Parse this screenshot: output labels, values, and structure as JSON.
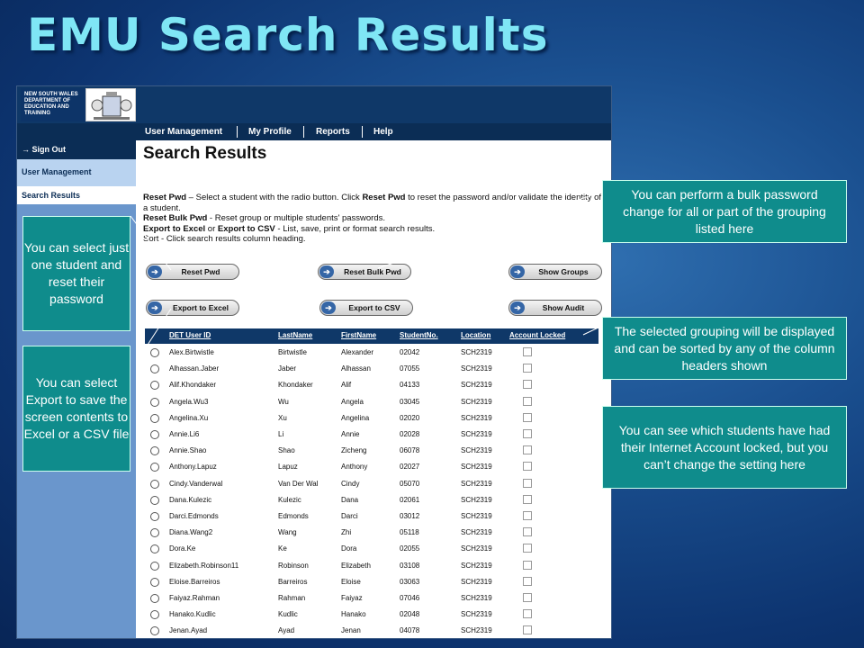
{
  "slide": {
    "title": "EMU Search Results"
  },
  "app": {
    "logo_text": "NEW SOUTH WALES DEPARTMENT OF EDUCATION AND TRAINING",
    "nav": [
      "User Management",
      "My Profile",
      "Reports",
      "Help"
    ],
    "sidebar": {
      "signout": "→ Sign Out",
      "user_management": "User Management",
      "search_results": "Search Results"
    },
    "page_heading": "Search Results",
    "instructions": {
      "reset_pwd_label": "Reset Pwd",
      "reset_pwd_pre": " – Select a student with the radio button. Click ",
      "reset_pwd_label2": "Reset Pwd",
      "reset_pwd_post": " to reset the password and/or validate the identity of a student.",
      "bulk_label": "Reset Bulk Pwd",
      "bulk_text": " - Reset group or multiple students' passwords.",
      "export_label": "Export to Excel",
      "export_or": " or ",
      "export_label2": "Export to CSV",
      "export_text": " - List, save, print or format search results.",
      "sort_text": "Sort - Click search results column heading."
    },
    "buttons": {
      "reset_pwd": "Reset Pwd",
      "reset_bulk": "Reset Bulk Pwd",
      "show_groups": "Show Groups",
      "export_excel": "Export to Excel",
      "export_csv": "Export to CSV",
      "show_audit": "Show Audit"
    },
    "table": {
      "headers": [
        "DET User ID",
        "LastName",
        "FirstName",
        "StudentNo.",
        "Location",
        "Account Locked"
      ],
      "rows": [
        [
          "Alex.Birtwistle",
          "Birtwistle",
          "Alexander",
          "02042",
          "SCH2319"
        ],
        [
          "Alhassan.Jaber",
          "Jaber",
          "Alhassan",
          "07055",
          "SCH2319"
        ],
        [
          "Alif.Khondaker",
          "Khondaker",
          "Alif",
          "04133",
          "SCH2319"
        ],
        [
          "Angela.Wu3",
          "Wu",
          "Angela",
          "03045",
          "SCH2319"
        ],
        [
          "Angelina.Xu",
          "Xu",
          "Angelina",
          "02020",
          "SCH2319"
        ],
        [
          "Annie.Li6",
          "Li",
          "Annie",
          "02028",
          "SCH2319"
        ],
        [
          "Annie.Shao",
          "Shao",
          "Zicheng",
          "06078",
          "SCH2319"
        ],
        [
          "Anthony.Lapuz",
          "Lapuz",
          "Anthony",
          "02027",
          "SCH2319"
        ],
        [
          "Cindy.Vanderwal",
          "Van Der Wal",
          "Cindy",
          "05070",
          "SCH2319"
        ],
        [
          "Dana.Kulezic",
          "Kulezic",
          "Dana",
          "02061",
          "SCH2319"
        ],
        [
          "Darci.Edmonds",
          "Edmonds",
          "Darci",
          "03012",
          "SCH2319"
        ],
        [
          "Diana.Wang2",
          "Wang",
          "Zhi",
          "05118",
          "SCH2319"
        ],
        [
          "Dora.Ke",
          "Ke",
          "Dora",
          "02055",
          "SCH2319"
        ],
        [
          "Elizabeth.Robinson11",
          "Robinson",
          "Elizabeth",
          "03108",
          "SCH2319"
        ],
        [
          "Eloise.Barreiros",
          "Barreiros",
          "Eloise",
          "03063",
          "SCH2319"
        ],
        [
          "Faiyaz.Rahman",
          "Rahman",
          "Faiyaz",
          "07046",
          "SCH2319"
        ],
        [
          "Hanako.Kudlic",
          "Kudlic",
          "Hanako",
          "02048",
          "SCH2319"
        ],
        [
          "Jenan.Ayad",
          "Ayad",
          "Jenan",
          "04078",
          "SCH2319"
        ]
      ]
    }
  },
  "callouts": {
    "select_one": "You can select just one student and reset their password",
    "select_export": "You can select Export to save the screen contents to Excel or a CSV file",
    "bulk_password": "You can perform a bulk password change for all or part of the grouping listed here",
    "grouping": "The selected grouping will be displayed and can be sorted by any of the column headers shown",
    "locked": "You can see which students have had their Internet Account locked, but you can’t change the setting here"
  },
  "colors": {
    "title": "#7fe6f5",
    "callout": "#0f8c8c",
    "banner": "#0f3868"
  }
}
